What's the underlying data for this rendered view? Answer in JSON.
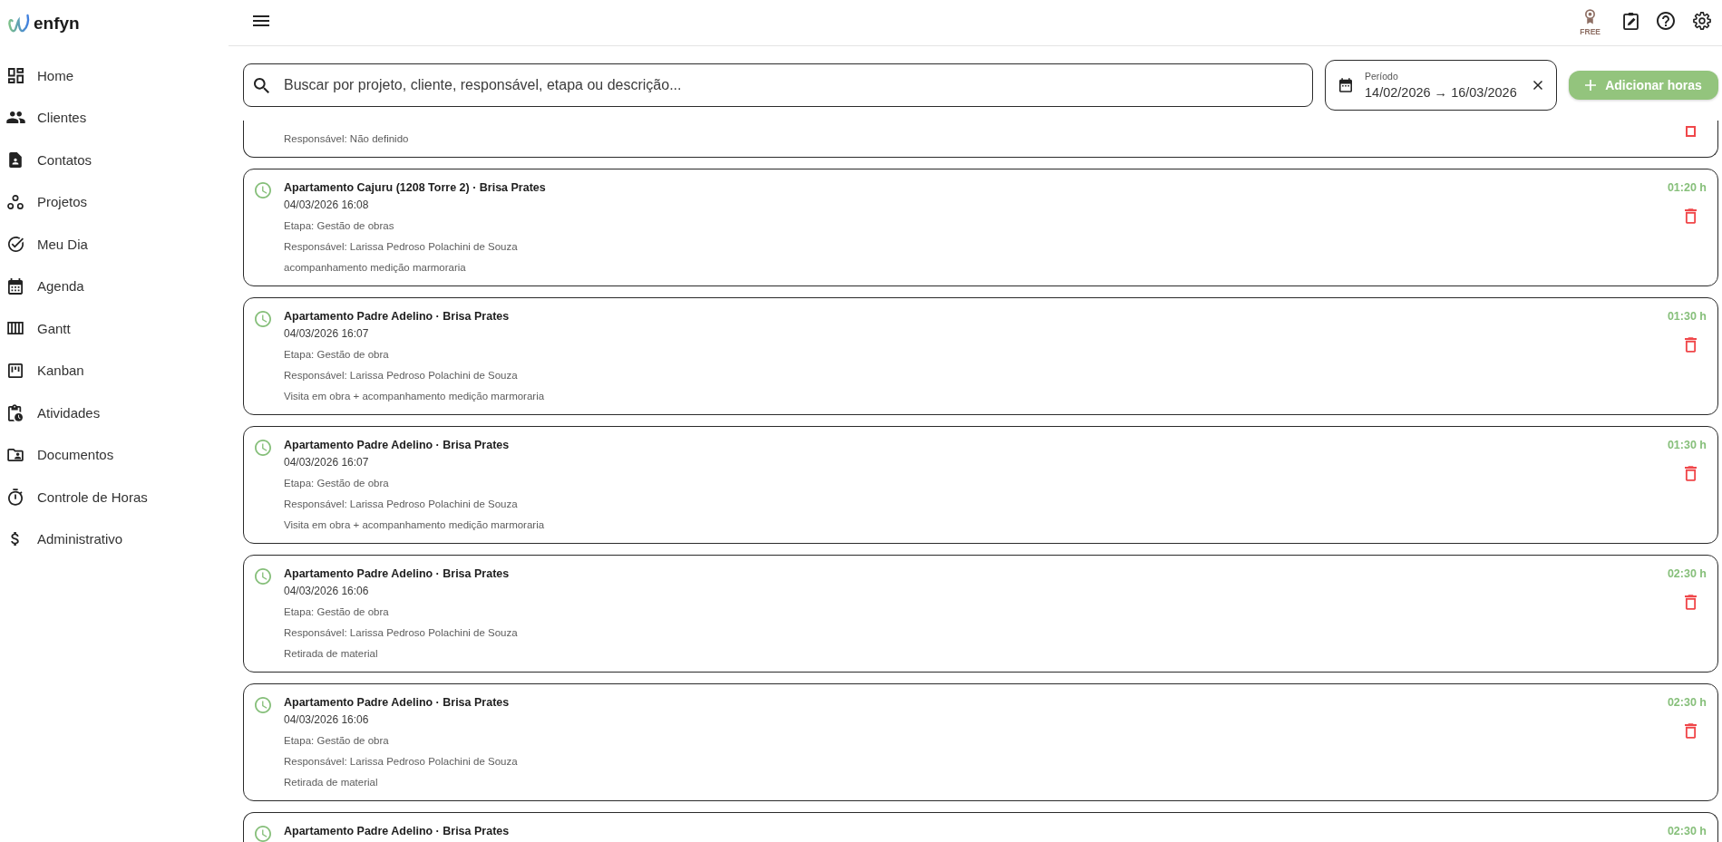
{
  "sidebar": {
    "logo_text": "enfyn",
    "items": [
      {
        "label": "Home"
      },
      {
        "label": "Clientes"
      },
      {
        "label": "Contatos"
      },
      {
        "label": "Projetos"
      },
      {
        "label": "Meu Dia"
      },
      {
        "label": "Agenda"
      },
      {
        "label": "Gantt"
      },
      {
        "label": "Kanban"
      },
      {
        "label": "Atividades"
      },
      {
        "label": "Documentos"
      },
      {
        "label": "Controle de Horas"
      },
      {
        "label": "Administrativo"
      }
    ]
  },
  "topbar": {
    "plan_badge": "FREE"
  },
  "search": {
    "placeholder": "Buscar por projeto, cliente, responsável, etapa ou descrição..."
  },
  "period": {
    "label": "Período",
    "value": "14/02/2026 → 16/03/2026"
  },
  "add_button": {
    "label": "Adicionar horas"
  },
  "entries": [
    {
      "kind": "cut_top",
      "responsible": "Responsável: Não definido"
    },
    {
      "kind": "full",
      "title": "Apartamento Cajuru (1208 Torre 2) · Brisa Prates",
      "datetime": "04/03/2026 16:08",
      "stage": "Etapa: Gestão de obras",
      "responsible": "Responsável: Larissa Pedroso Polachini de Souza",
      "description": "acompanhamento medição marmoraria",
      "hours": "01:20 h"
    },
    {
      "kind": "full",
      "title": "Apartamento Padre Adelino · Brisa Prates",
      "datetime": "04/03/2026 16:07",
      "stage": "Etapa: Gestão de obra",
      "responsible": "Responsável: Larissa Pedroso Polachini de Souza",
      "description": "Visita em obra + acompanhamento medição marmoraria",
      "hours": "01:30 h"
    },
    {
      "kind": "full",
      "title": "Apartamento Padre Adelino · Brisa Prates",
      "datetime": "04/03/2026 16:07",
      "stage": "Etapa: Gestão de obra",
      "responsible": "Responsável: Larissa Pedroso Polachini de Souza",
      "description": "Visita em obra + acompanhamento medição marmoraria",
      "hours": "01:30 h"
    },
    {
      "kind": "full",
      "title": "Apartamento Padre Adelino · Brisa Prates",
      "datetime": "04/03/2026 16:06",
      "stage": "Etapa: Gestão de obra",
      "responsible": "Responsável: Larissa Pedroso Polachini de Souza",
      "description": "Retirada de material",
      "hours": "02:30 h"
    },
    {
      "kind": "full",
      "title": "Apartamento Padre Adelino · Brisa Prates",
      "datetime": "04/03/2026 16:06",
      "stage": "Etapa: Gestão de obra",
      "responsible": "Responsável: Larissa Pedroso Polachini de Souza",
      "description": "Retirada de material",
      "hours": "02:30 h"
    },
    {
      "kind": "cut_bottom",
      "title": "Apartamento Padre Adelino · Brisa Prates",
      "hours": "02:30 h"
    }
  ]
}
